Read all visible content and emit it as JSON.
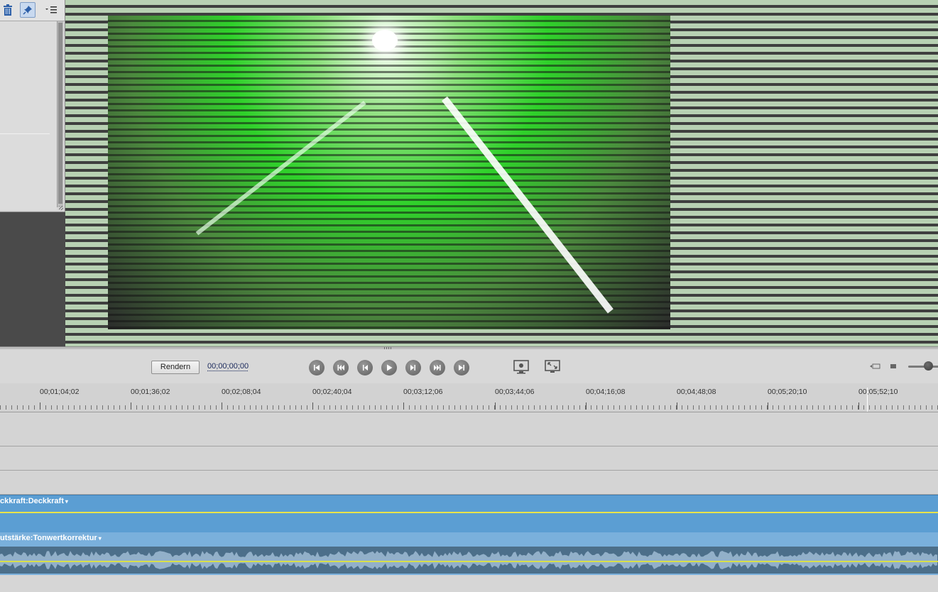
{
  "panel": {
    "toolbar": {
      "trash_icon": "trash-icon",
      "pin_icon": "pin-icon",
      "menu_icon": "panel-menu-icon"
    }
  },
  "transport": {
    "render_label": "Rendern",
    "timecode": "00;00;00;00",
    "controls": [
      "go-to-start",
      "step-back-large",
      "step-back",
      "play",
      "step-forward",
      "step-forward-large",
      "go-to-end"
    ],
    "monitor_icons": [
      "safe-margins-icon",
      "fullscreen-icon"
    ]
  },
  "ruler": {
    "labels": [
      "00;01;04;02",
      "00;01;36;02",
      "00;02;08;04",
      "00;02;40;04",
      "00;03;12;06",
      "00;03;44;06",
      "00;04;16;08",
      "00;04;48;08",
      "00;05;20;10",
      "00;05;52;10"
    ]
  },
  "tracks": {
    "video_label": "ckkraft:Deckkraft",
    "audio_label": "utstärke:Tonwertkorrektur"
  },
  "colors": {
    "video_track": "#5b9ed3",
    "audio_track": "#7ab0dc",
    "keyframe_line": "#e8e34a"
  }
}
